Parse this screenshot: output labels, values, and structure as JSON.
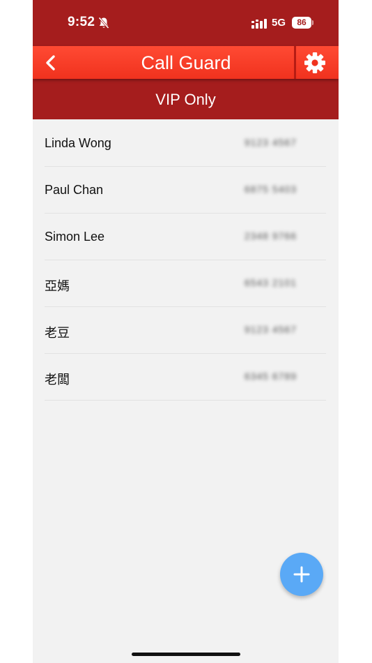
{
  "status_bar": {
    "time": "9:52",
    "network": "5G",
    "battery": "86"
  },
  "header": {
    "title": "Call Guard"
  },
  "sub_header": {
    "title": "VIP Only"
  },
  "contacts": [
    {
      "name": "Linda Wong",
      "number": "9123 4567"
    },
    {
      "name": "Paul Chan",
      "number": "6875 5403"
    },
    {
      "name": "Simon Lee",
      "number": "2348 9766"
    },
    {
      "name": "亞媽",
      "number": "6543 2101"
    },
    {
      "name": "老豆",
      "number": "9123 4567"
    },
    {
      "name": "老闆",
      "number": "6345 6789"
    }
  ],
  "icons": {
    "back": "chevron-left-icon",
    "settings": "gear-icon",
    "add": "plus-icon",
    "silent": "bell-slash-icon"
  },
  "colors": {
    "status_bar": "#a51d1d",
    "header": "#f0321e",
    "sub_header": "#a51d1d",
    "fab": "#5aa9f6",
    "background": "#f2f2f2"
  }
}
